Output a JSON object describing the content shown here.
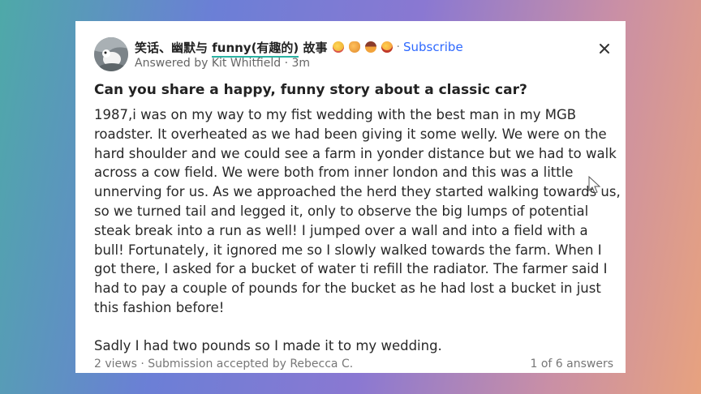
{
  "space": {
    "name_prefix": "笑话、幽默与 ",
    "name_highlight": "funny(有趣的)",
    "name_suffix": " 故事",
    "emoji_icons": [
      "star-struck-emoji-icon",
      "cat-emoji-icon",
      "cowboy-emoji-icon",
      "grinning-emoji-icon"
    ],
    "subscribe_label": "Subscribe"
  },
  "answer_meta": "Answered by Kit Whitfield · 3m",
  "question": "Can you share a happy, funny story about a classic car?",
  "answer_paragraphs": [
    "1987,i was on my way to my fist wedding with the best man in my MGB roadster. It overheated as we had been giving it some welly. We were on the hard shoulder and we could see a farm in yonder distance but we had to walk across a cow field. We were both from inner london and this was a little unnerving for us. As we approached the herd they started walking towards us, so we turned tail and legged it, only to observe the big lumps of potential steak break into a run as well! I jumped over a wall and into a field with a bull! Fortunately, it ignored me so I slowly walked towards the farm. When I got there, I asked for a bucket of water ti refill the radiator. The farmer said I had to pay a couple of pounds for the bucket as he had lost a bucket in just this fashion before!",
    "Sadly I had two pounds so I made it to my wedding."
  ],
  "footer": {
    "stats": "2 views · Submission accepted by Rebecca C.",
    "answer_count": "1 of 6 answers"
  },
  "colors": {
    "accent": "#2e69ff",
    "underline": "#2bb3a3",
    "card": "#ffffff"
  }
}
